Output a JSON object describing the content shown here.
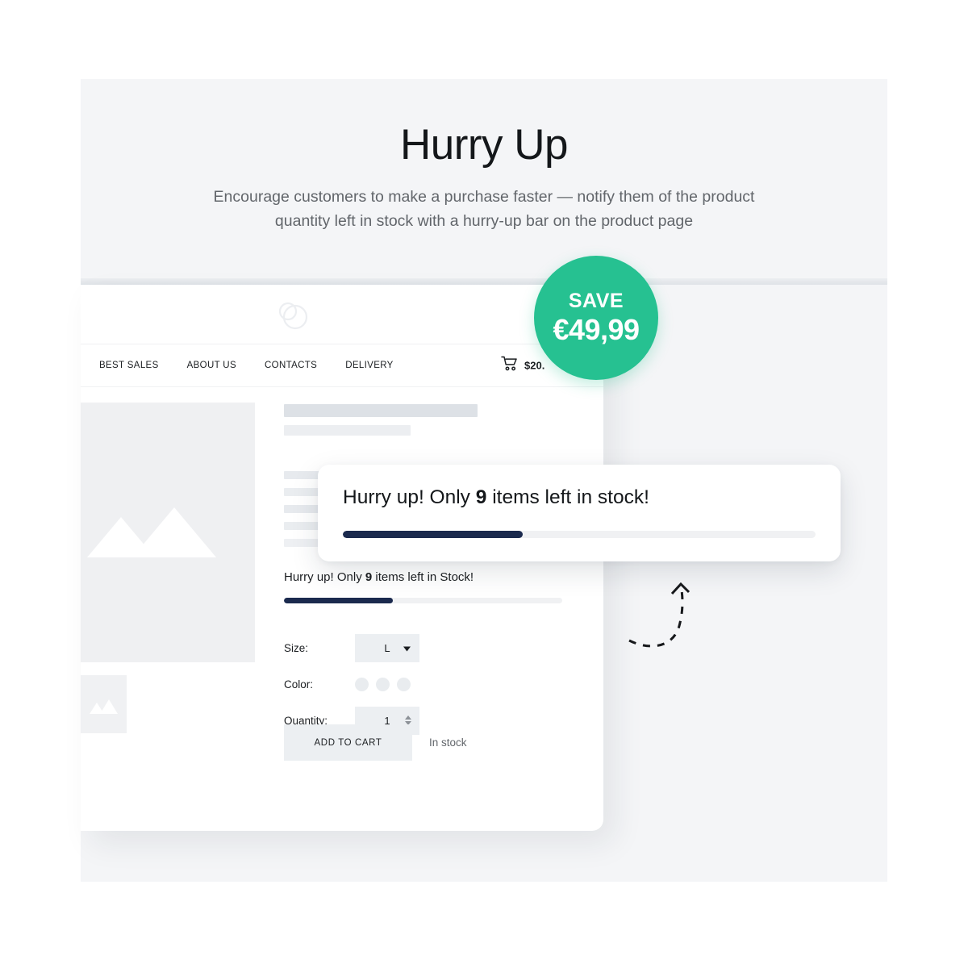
{
  "hero": {
    "title": "Hurry Up",
    "subtitle": "Encourage customers to make a purchase faster — notify them of the product quantity left in stock with a hurry-up bar on the product page"
  },
  "badge": {
    "save_label": "SAVE",
    "amount": "€49,99",
    "color": "#26c191"
  },
  "shop": {
    "logo_icon": "overlapping-circles-logo",
    "nav": [
      {
        "label": "BEST SALES"
      },
      {
        "label": "ABOUT US"
      },
      {
        "label": "CONTACTS"
      },
      {
        "label": "DELIVERY"
      }
    ],
    "cart": {
      "icon": "shopping-cart-icon",
      "total": "$20."
    }
  },
  "product": {
    "gallery": {
      "main_placeholder_icon": "image-placeholder-icon",
      "thumb_placeholder_icon": "image-placeholder-icon"
    },
    "hurry_inline": {
      "text_before": "Hurry up! Only ",
      "count": "9",
      "text_after": " items left in Stock!",
      "progress_percent": 39,
      "fill_color": "#1b2a4e",
      "track_color": "#f0f1f3"
    },
    "options": {
      "size": {
        "label": "Size:",
        "value": "L",
        "caret_icon": "chevron-down-icon"
      },
      "color": {
        "label": "Color:",
        "swatch_count": 3
      },
      "quantity": {
        "label": "Quantity:",
        "value": "1",
        "spinner_icon": "stepper-arrows-icon"
      }
    },
    "cta": {
      "add_to_cart_label": "ADD TO CART",
      "stock_status": "In stock"
    }
  },
  "callout": {
    "text_before": "Hurry up! Only ",
    "count": "9",
    "text_after": " items left in stock!",
    "progress_percent": 38,
    "fill_color": "#1b2a4e",
    "track_color": "#f0f1f3"
  },
  "decoration": {
    "arrow_icon": "dashed-curved-arrow-icon"
  }
}
